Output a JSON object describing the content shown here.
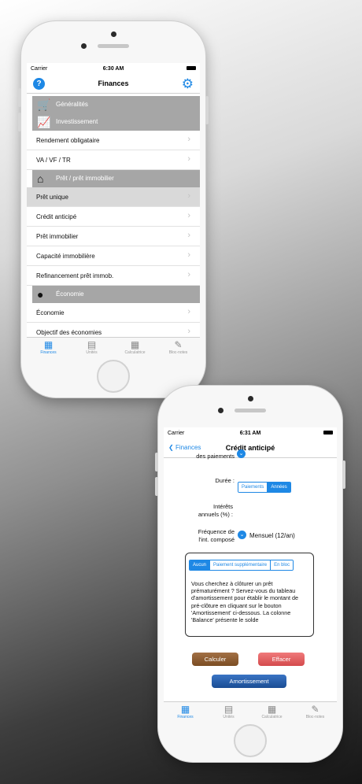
{
  "phone1": {
    "status": {
      "carrier": "Carrier",
      "time": "6:30 AM"
    },
    "nav": {
      "title": "Finances",
      "help_icon": "?",
      "settings_icon": "gear-icon"
    },
    "sections": {
      "generalites": "Généralités",
      "investissement": "Investissement",
      "pret": "Prêt / prêt immobilier",
      "economie": "Économie"
    },
    "rows": {
      "rendement": "Rendement obligataire",
      "va": "VA / VF / TR",
      "pret_unique": "Prêt unique",
      "credit": "Crédit anticipé",
      "pret_immo": "Prêt immobilier",
      "capacite": "Capacité immobilière",
      "refinancement": "Refinancement prêt immob.",
      "economie": "Économie",
      "objectif": "Objectif des économies"
    },
    "tabs": [
      "Finances",
      "Unités",
      "Calculatrice",
      "Bloc-notes"
    ]
  },
  "phone2": {
    "status": {
      "carrier": "Carrier",
      "time": "6:31 AM"
    },
    "nav": {
      "back": "Finances",
      "title": "Crédit anticipé"
    },
    "partial_label": "des paiements",
    "duree_label": "Durée :",
    "duree_seg": [
      "Paiements",
      "Années"
    ],
    "interets_label_1": "Intérêts",
    "interets_label_2": "annuels (%) :",
    "freq_label_1": "Fréquence de",
    "freq_label_2": "l'int. composé",
    "freq_value": "Mensuel (12/an)",
    "info_seg": [
      "Aucun",
      "Paiement supplémentaire",
      "En bloc"
    ],
    "info_text": "Vous cherchez à clôturer un prêt prématurément ? Servez-vous du tableau d'amortissement pour établir le montant de pré-clôture en cliquant sur le bouton 'Amortissement' ci-dessous. La colonne 'Balance' présente le solde",
    "btn_calculer": "Calculer",
    "btn_effacer": "Effacer",
    "btn_amortissement": "Amortissement",
    "tabs": [
      "Finances",
      "Unités",
      "Calculatrice",
      "Bloc-notes"
    ]
  },
  "colors": {
    "accent": "#1e88e5",
    "section": "#a6a6a6",
    "calculer": "#8a5a2b",
    "effacer": "#e0585a",
    "amortissement": "#1f5aa8"
  }
}
